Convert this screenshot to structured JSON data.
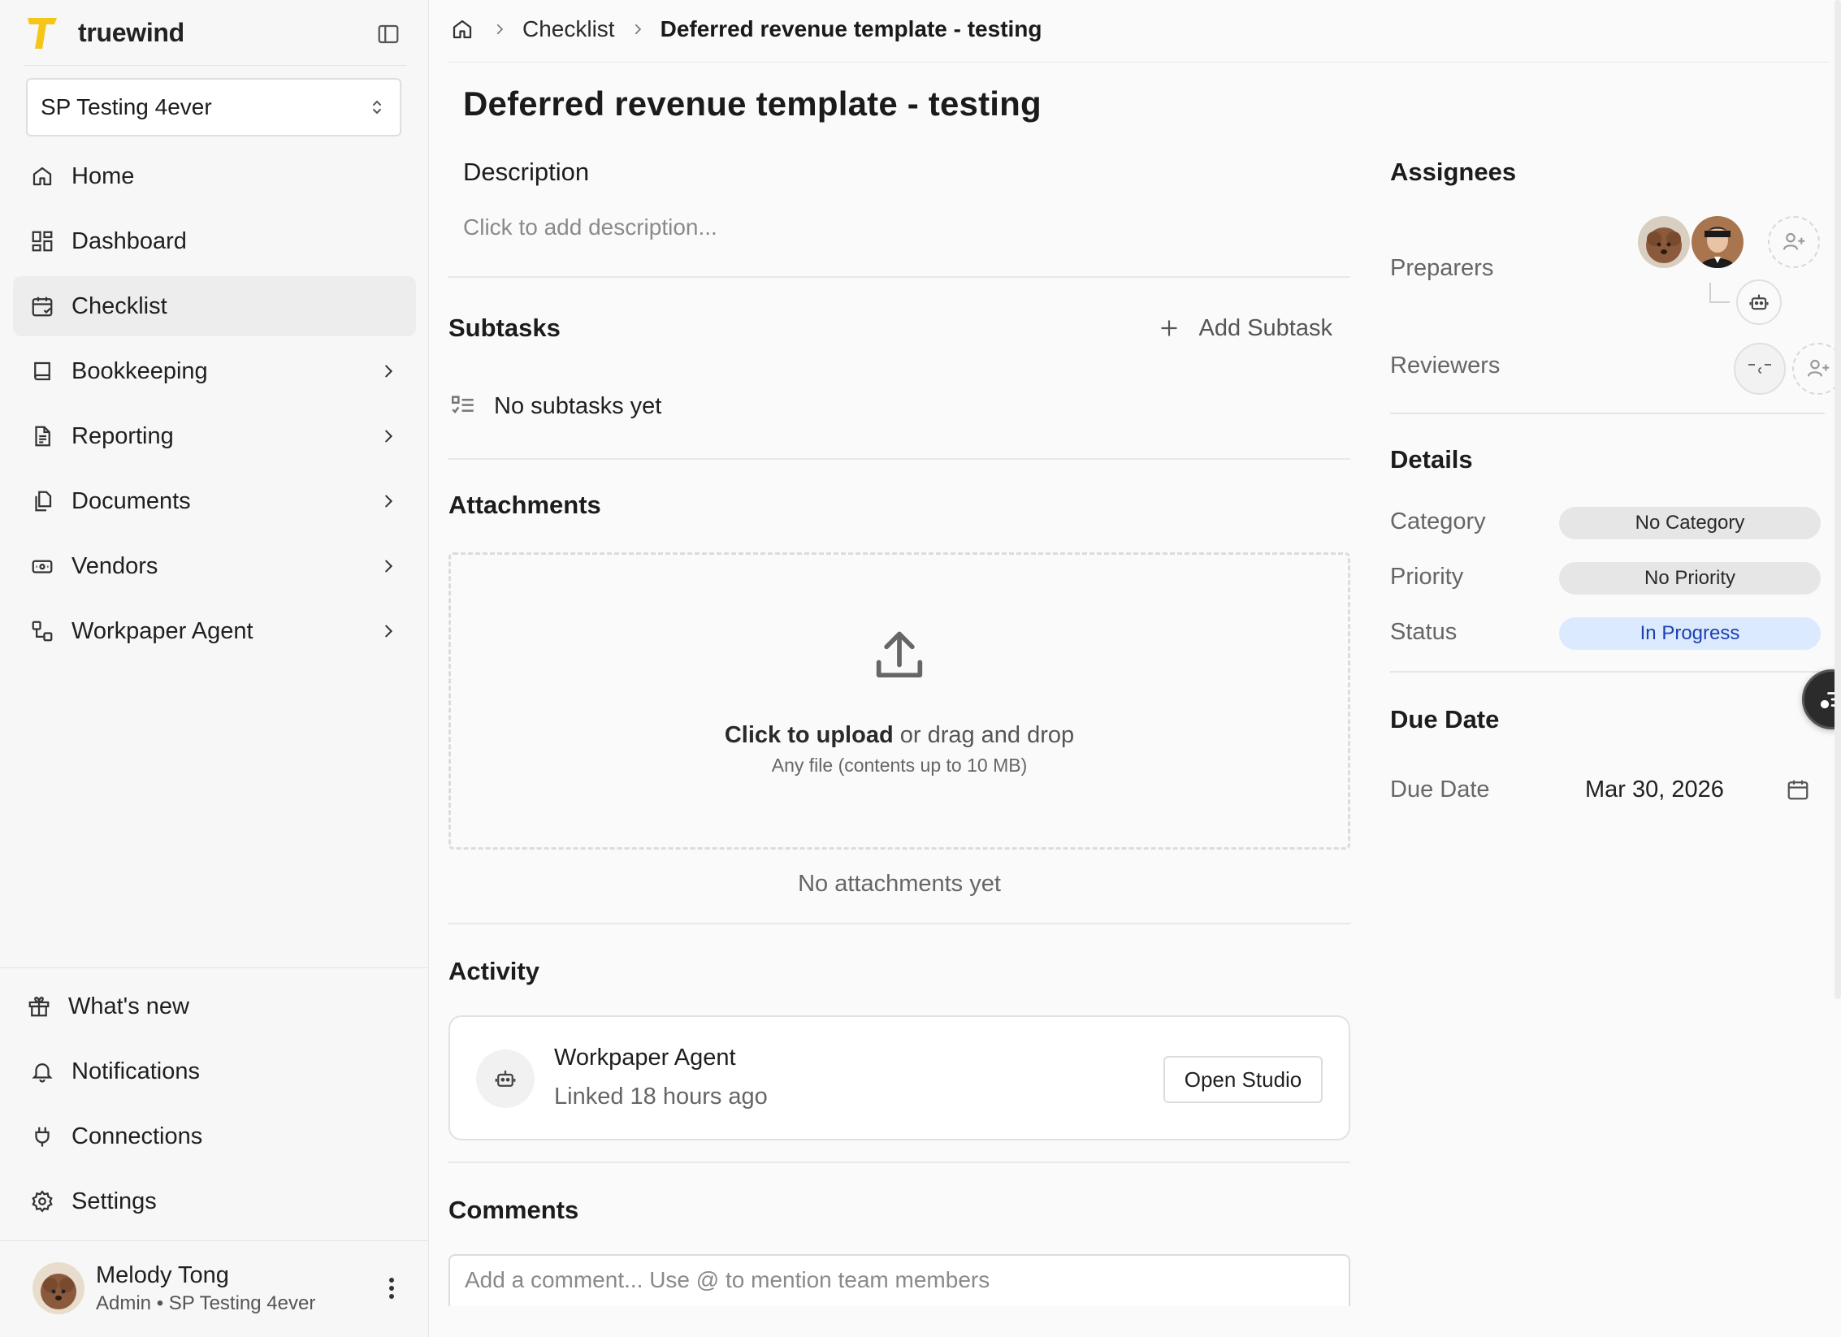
{
  "brand": {
    "name": "truewind"
  },
  "org": {
    "name": "SP Testing 4ever"
  },
  "nav": [
    {
      "label": "Home",
      "icon": "home-icon"
    },
    {
      "label": "Dashboard",
      "icon": "dashboard-icon"
    },
    {
      "label": "Checklist",
      "icon": "calendar-check-icon",
      "active": true
    },
    {
      "label": "Bookkeeping",
      "icon": "book-icon",
      "chevron": true
    },
    {
      "label": "Reporting",
      "icon": "report-icon",
      "chevron": true
    },
    {
      "label": "Documents",
      "icon": "documents-icon",
      "chevron": true
    },
    {
      "label": "Vendors",
      "icon": "vendors-icon",
      "chevron": true
    },
    {
      "label": "Workpaper Agent",
      "icon": "workflow-icon",
      "chevron": true
    }
  ],
  "nav_bottom": [
    {
      "label": "What's new",
      "icon": "gift-icon"
    },
    {
      "label": "Notifications",
      "icon": "bell-icon"
    },
    {
      "label": "Connections",
      "icon": "plug-icon"
    },
    {
      "label": "Settings",
      "icon": "gear-icon"
    }
  ],
  "user": {
    "name": "Melody Tong",
    "role": "Admin • SP Testing 4ever"
  },
  "breadcrumb": {
    "parent": "Checklist",
    "current": "Deferred revenue template - testing"
  },
  "page": {
    "title": "Deferred revenue template - testing"
  },
  "description": {
    "title": "Description",
    "placeholder": "Click to add description..."
  },
  "subtasks": {
    "title": "Subtasks",
    "add_label": "Add Subtask",
    "empty": "No subtasks yet"
  },
  "attachments": {
    "title": "Attachments",
    "upload_bold": "Click to upload",
    "upload_rest": " or drag and drop",
    "hint": "Any file (contents up to 10 MB)",
    "empty": "No attachments yet"
  },
  "activity": {
    "title": "Activity",
    "item_title": "Workpaper Agent",
    "item_sub": "Linked 18 hours ago",
    "button": "Open Studio"
  },
  "comments": {
    "title": "Comments",
    "placeholder": "Add a comment... Use @ to mention team members"
  },
  "assignees": {
    "title": "Assignees",
    "preparers_label": "Preparers",
    "reviewers_label": "Reviewers"
  },
  "details": {
    "title": "Details",
    "category_label": "Category",
    "category_value": "No Category",
    "priority_label": "Priority",
    "priority_value": "No Priority",
    "status_label": "Status",
    "status_value": "In Progress"
  },
  "due": {
    "title": "Due Date",
    "label": "Due Date",
    "value": "Mar 30, 2026"
  },
  "colors": {
    "brand_yellow": "#f5c518",
    "status_blue_bg": "#dbeafe",
    "status_blue_text": "#1e40af"
  }
}
